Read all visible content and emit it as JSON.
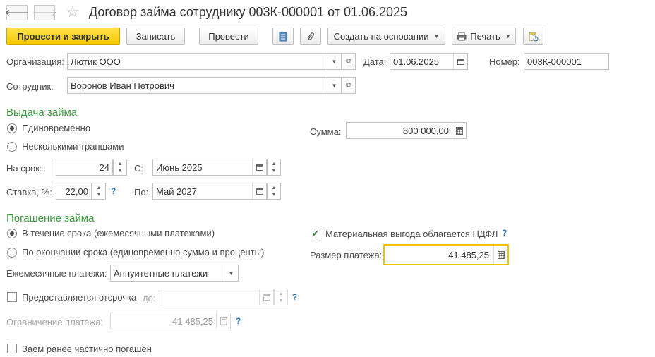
{
  "window": {
    "title": "Договор займа сотруднику 003К-000001 от 01.06.2025",
    "back_icon": "arrow-left-icon",
    "forward_icon": "arrow-right-icon",
    "favorite_icon": "star-icon"
  },
  "toolbar": {
    "post_and_close": "Провести и закрыть",
    "save": "Записать",
    "post": "Провести",
    "create_based_on": "Создать на основании",
    "print": "Печать",
    "icons": [
      "document-list-icon",
      "paperclip-icon",
      "printer-icon",
      "report-structure-icon"
    ]
  },
  "header": {
    "organization_label": "Организация:",
    "organization_value": "Лютик ООО",
    "date_label": "Дата:",
    "date_value": "01.06.2025",
    "number_label": "Номер:",
    "number_value": "003К-000001",
    "employee_label": "Сотрудник:",
    "employee_value": "Воронов Иван Петрович"
  },
  "issue": {
    "section_title": "Выдача займа",
    "option_lump_sum": "Единовременно",
    "option_tranches": "Несколькими траншами",
    "selected": "Единовременно",
    "amount_label": "Сумма:",
    "amount_value": "800 000,00",
    "term_label": "На срок:",
    "term_value": "24",
    "from_label": "С:",
    "from_value": "Июнь 2025",
    "rate_label": "Ставка, %:",
    "rate_value": "22,00",
    "to_label": "По:",
    "to_value": "Май 2027",
    "help_mark": "?"
  },
  "repayment": {
    "section_title": "Погашение займа",
    "option_during_term": "В течение срока (ежемесячными платежами)",
    "option_end_of_term": "По окончании срока (единовременно сумма и проценты)",
    "selected": "В течение срока (ежемесячными платежами)",
    "ndfl_checkbox_label": "Материальная выгода облагается НДФЛ",
    "ndfl_checked": true,
    "payment_size_label": "Размер платежа:",
    "payment_size_value": "41 485,25",
    "monthly_label": "Ежемесячные платежи:",
    "monthly_value": "Аннуитетные платежи",
    "deferral_label": "Предоставляется отсрочка",
    "deferral_checked": false,
    "deferral_to_label": "до:",
    "deferral_to_value": "",
    "limit_label": "Ограничение платежа:",
    "limit_value": "41 485,25",
    "partially_repaid_label": "Заем ранее частично погашен",
    "partially_repaid_checked": false,
    "help_mark": "?"
  },
  "colors": {
    "accent_yellow": "#f5c800",
    "section_green": "#3c9a3c",
    "help_blue": "#2f7fc9",
    "focus_border": "#f2c200"
  }
}
